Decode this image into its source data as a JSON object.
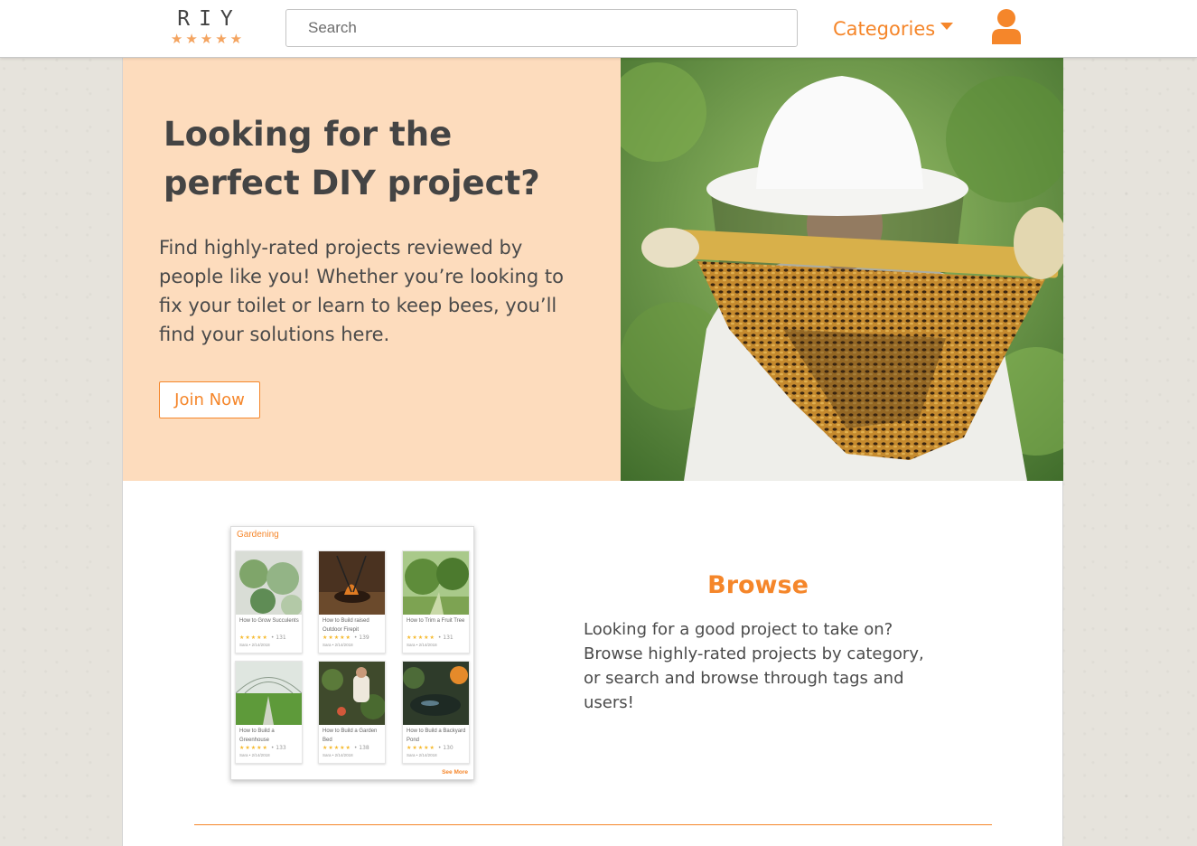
{
  "header": {
    "logo_text": "RIY",
    "logo_stars": "★★★★★",
    "search_placeholder": "Search",
    "categories_label": "Categories"
  },
  "hero": {
    "title": "Looking for the perfect DIY project?",
    "description": "Find highly-rated projects reviewed by people like you! Whether you’re looking to fix your toilet or learn to keep bees, you’ll find your solutions here.",
    "join_label": "Join Now"
  },
  "browse": {
    "title": "Browse",
    "description": "Looking for a good project to take on? Browse highly-rated projects by category, or search and browse through tags and users!",
    "preview": {
      "heading": "Gardening",
      "see_more": "See More",
      "cards": [
        {
          "title": "How to Grow Succulents",
          "stars": "★★★★★",
          "count": "• 131",
          "meta": "Sara • 2/14/2018"
        },
        {
          "title": "How to Build raised Outdoor Firepit",
          "stars": "★★★★★",
          "count": "• 139",
          "meta": "Sara • 2/14/2018"
        },
        {
          "title": "How to Trim a Fruit Tree",
          "stars": "★★★★★",
          "count": "• 131",
          "meta": "Sara • 2/14/2018"
        },
        {
          "title": "How to Build a Greenhouse",
          "stars": "★★★★★",
          "count": "• 133",
          "meta": "Sara • 2/14/2018"
        },
        {
          "title": "How to Build a Garden Bed",
          "stars": "★★★★★",
          "count": "• 138",
          "meta": "Sara • 2/14/2018"
        },
        {
          "title": "How to Build a Backyard Pond",
          "stars": "★★★★★",
          "count": "• 130",
          "meta": "Sara • 2/14/2018"
        }
      ]
    }
  },
  "colors": {
    "accent": "#f5862a",
    "hero_bg": "#fddcbd",
    "star": "#f6b92b"
  }
}
